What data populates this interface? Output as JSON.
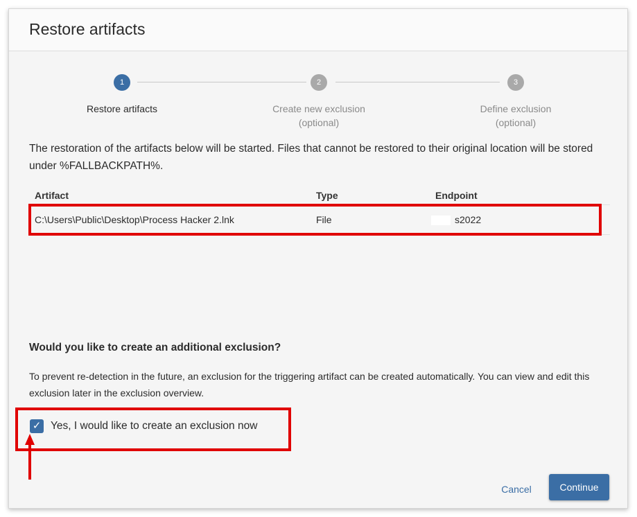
{
  "dialog": {
    "title": "Restore artifacts"
  },
  "stepper": {
    "steps": [
      {
        "number": "1",
        "label": "Restore artifacts",
        "sublabel": "",
        "state": "active"
      },
      {
        "number": "2",
        "label": "Create new exclusion",
        "sublabel": "(optional)",
        "state": "inactive"
      },
      {
        "number": "3",
        "label": "Define exclusion",
        "sublabel": "(optional)",
        "state": "inactive"
      }
    ]
  },
  "intro": {
    "text": "The restoration of the artifacts below will be started. Files that cannot be restored to their original location will be stored under %FALLBACKPATH%."
  },
  "table": {
    "headers": {
      "artifact": "Artifact",
      "type": "Type",
      "endpoint": "Endpoint"
    },
    "rows": [
      {
        "artifact": "C:\\Users\\Public\\Desktop\\Process Hacker 2.lnk",
        "type": "File",
        "endpoint": "s2022"
      }
    ]
  },
  "exclusion": {
    "question": "Would you like to create an additional exclusion?",
    "explanation": "To prevent re-detection in the future, an exclusion for the triggering artifact can be created automatically. You can view and edit this exclusion later in the exclusion overview.",
    "checkbox_label": "Yes, I would like to create an exclusion now",
    "checked": true
  },
  "footer": {
    "cancel_label": "Cancel",
    "continue_label": "Continue"
  },
  "colors": {
    "accent": "#3b6ea5",
    "annotation": "#e00000",
    "inactive_step": "#a9a9a9"
  }
}
